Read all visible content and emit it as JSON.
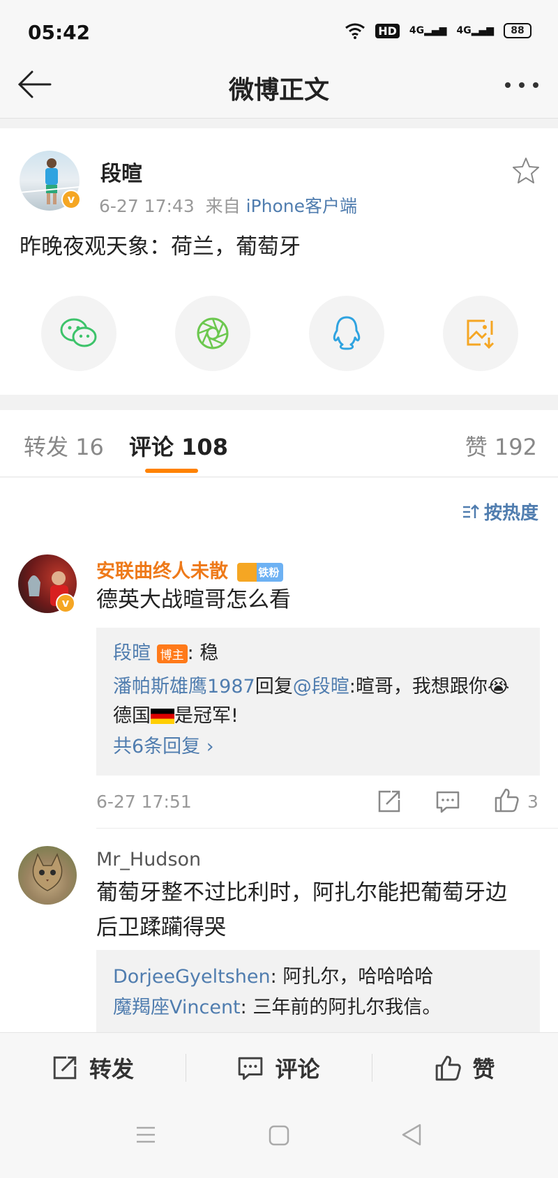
{
  "status": {
    "time": "05:42",
    "hd": "HD",
    "signal1": "4G",
    "signal2": "4G",
    "battery": "88"
  },
  "nav": {
    "title": "微博正文"
  },
  "post": {
    "author": "段暄",
    "time": "6-27 17:43",
    "from_label": "来自",
    "source": "iPhone客户端",
    "content": "昨晚夜观天象：荷兰，葡萄牙"
  },
  "share_icons": [
    "wechat-icon",
    "moments-icon",
    "qq-icon",
    "save-image-icon"
  ],
  "tabs": {
    "repost_label": "转发",
    "repost_count": "16",
    "comment_label": "评论",
    "comment_count": "108",
    "like_label": "赞",
    "like_count": "192"
  },
  "sort_label": "按热度",
  "comments": [
    {
      "author": "安联曲终人未散",
      "badge": "铁粉",
      "text": "德英大战暄哥怎么看",
      "replies": [
        {
          "author": "段暄",
          "tag": "博主",
          "sep": ":",
          "text": " 稳"
        },
        {
          "author": "潘帕斯雄鹰1987",
          "reply_word": "回复",
          "mention": "@段暄",
          "text": ":暄哥，我想跟你",
          "text2": "德国",
          "text3": "是冠军!"
        }
      ],
      "more_replies": "共6条回复",
      "time": "6-27 17:51",
      "likes": "3"
    },
    {
      "author": "Mr_Hudson",
      "text_line1": "葡萄牙整不过比利时，阿扎尔能把葡萄牙边",
      "text_line2": "后卫蹂躏得哭",
      "replies": [
        {
          "author": "DorjeeGyeltshen",
          "text": ": 阿扎尔，哈哈哈哈"
        },
        {
          "author": "魔羯座Vincent",
          "text": ": 三年前的阿扎尔我信。"
        }
      ]
    }
  ],
  "bottom_bar": {
    "repost": "转发",
    "comment": "评论",
    "like": "赞"
  }
}
